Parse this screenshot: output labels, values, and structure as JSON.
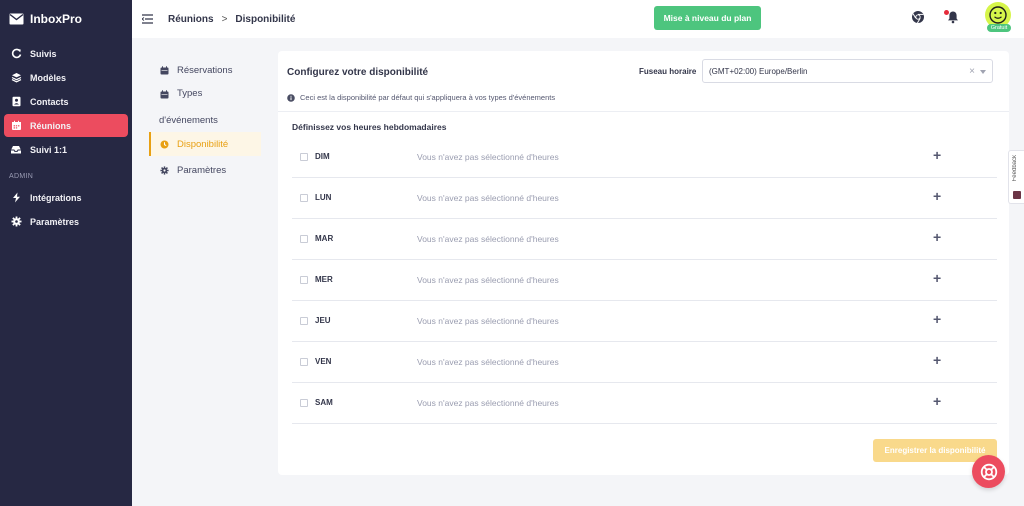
{
  "app": {
    "name": "InboxPro"
  },
  "sidebar": {
    "items": [
      {
        "label": "Suivis",
        "icon": "refresh-icon"
      },
      {
        "label": "Modèles",
        "icon": "layers-icon"
      },
      {
        "label": "Contacts",
        "icon": "contact-card-icon"
      },
      {
        "label": "Réunions",
        "icon": "calendar-icon",
        "active": true
      },
      {
        "label": "Suivi 1:1",
        "icon": "inbox-tray-icon"
      }
    ],
    "admin_label": "ADMIN",
    "admin_items": [
      {
        "label": "Intégrations",
        "icon": "bolt-icon"
      },
      {
        "label": "Paramètres",
        "icon": "gear-icon"
      }
    ]
  },
  "header": {
    "breadcrumb": {
      "root": "Réunions",
      "separator": ">",
      "current": "Disponibilité"
    },
    "upgrade_label": "Mise à niveau du plan",
    "plan_badge": "Gratuit"
  },
  "subnav": {
    "items": [
      {
        "label": "Réservations",
        "icon": "calendar-icon"
      },
      {
        "label": "Types",
        "label_line2": "d'événements",
        "icon": "calendar-icon"
      },
      {
        "label": "Disponibilité",
        "icon": "clock-icon",
        "active": true
      },
      {
        "label": "Paramètres",
        "icon": "gear-icon"
      }
    ]
  },
  "availability": {
    "title": "Configurez votre disponibilité",
    "timezone_label": "Fuseau horaire",
    "timezone_value": "(GMT+02:00) Europe/Berlin",
    "clear_symbol": "×",
    "info": "Ceci est la disponibilité par défaut qui s'appliquera à vos types d'événements",
    "weekly_title": "Définissez vos heures hebdomadaires",
    "empty_text": "Vous n'avez pas sélectionné d'heures",
    "add_symbol": "+",
    "days": [
      {
        "day": "DIM",
        "status": "Vous n'avez pas sélectionné d'heures"
      },
      {
        "day": "LUN",
        "status": "Vous n'avez pas sélectionné d'heures"
      },
      {
        "day": "MAR",
        "status": "Vous n'avez pas sélectionné d'heures"
      },
      {
        "day": "MER",
        "status": "Vous n'avez pas sélectionné d'heures"
      },
      {
        "day": "JEU",
        "status": "Vous n'avez pas sélectionné d'heures"
      },
      {
        "day": "VEN",
        "status": "Vous n'avez pas sélectionné d'heures"
      },
      {
        "day": "SAM",
        "status": "Vous n'avez pas sélectionné d'heures"
      }
    ],
    "save_label": "Enregistrer la disponibilité"
  },
  "feedback": {
    "label": "Feedback"
  },
  "colors": {
    "sidebar_bg": "#262843",
    "active_red": "#ec4c5f",
    "upgrade_green": "#4dc57e",
    "accent_orange": "#e8a013",
    "save_yellow": "#f9d98b"
  }
}
